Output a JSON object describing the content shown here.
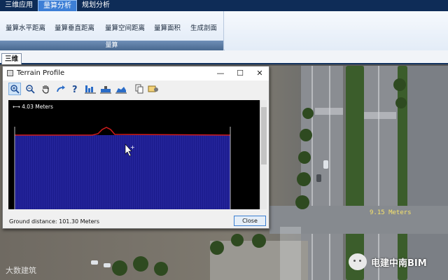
{
  "menu": {
    "tabs": [
      "三维应用",
      "量算分析",
      "规划分析"
    ],
    "active_index": 1
  },
  "ribbon": {
    "buttons": [
      "量算水平距离",
      "量算垂直距离",
      "量算空间距离",
      "量算面积",
      "生成剖面"
    ],
    "group_label": "量算"
  },
  "doc_tab": {
    "label": "三维"
  },
  "terrain_profile": {
    "title": "Terrain Profile",
    "scale_label": "4.03 Meters",
    "ground_distance": "Ground distance: 101.30 Meters",
    "close_label": "Close",
    "window_controls": {
      "minimize": "—",
      "maximize": "☐",
      "close": "✕"
    }
  },
  "map": {
    "road_label": "9.15 Meters"
  },
  "watermarks": {
    "left": "大数建筑",
    "right": "电建中南BIM"
  },
  "colors": {
    "menubar": "#0e2c57",
    "active_tab": "#3d7fd6",
    "profile_fill": "#1a1a8c",
    "profile_line": "#d21c1c",
    "close_border": "#3c7fd1"
  }
}
